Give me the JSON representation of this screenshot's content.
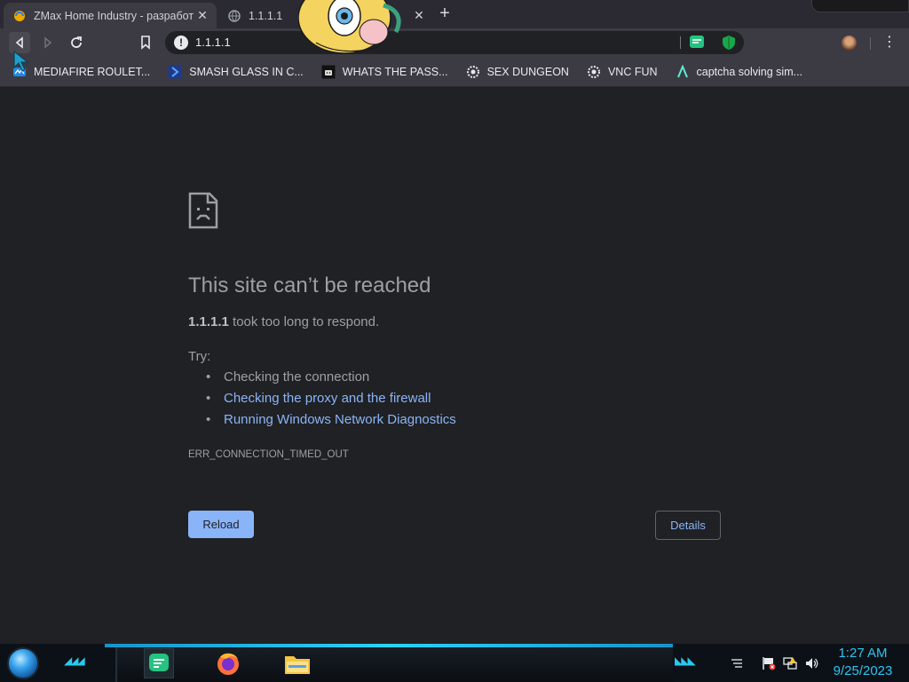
{
  "tabs": [
    {
      "title": "ZMax Home Industry - разработк",
      "close": "✕"
    },
    {
      "title": "1.1.1.1",
      "close": "✕"
    }
  ],
  "new_tab_label": "+",
  "omnibox": {
    "url": "1.1.1.1",
    "info_icon": "!"
  },
  "menu_glyph": "⋮",
  "bookmarks": [
    {
      "label": "MEDIAFIRE ROULET...",
      "icon": "mediafire-icon"
    },
    {
      "label": "SMASH GLASS IN C...",
      "icon": "chevron-bookmark-icon"
    },
    {
      "label": "WHATS THE PASS...",
      "icon": "robot-icon"
    },
    {
      "label": "SEX DUNGEON",
      "icon": "gear-bookmark-icon"
    },
    {
      "label": "VNC FUN",
      "icon": "gear-bookmark-icon"
    },
    {
      "label": "captcha solving sim...",
      "icon": "lambda-icon"
    }
  ],
  "error": {
    "title": "This site can’t be reached",
    "host": "1.1.1.1",
    "message": " took too long to respond.",
    "try_label": "Try:",
    "suggestions": [
      "Checking the connection",
      "Checking the proxy and the firewall",
      "Running Windows Network Diagnostics"
    ],
    "code": "ERR_CONNECTION_TIMED_OUT",
    "reload_label": "Reload",
    "details_label": "Details"
  },
  "taskbar": {
    "time": "1:27 AM",
    "date": "9/25/2023"
  },
  "colors": {
    "page_bg": "#202124",
    "toolbar_bg": "#3c3b44",
    "link": "#8ab4f8",
    "clock": "#2ec4f0"
  }
}
